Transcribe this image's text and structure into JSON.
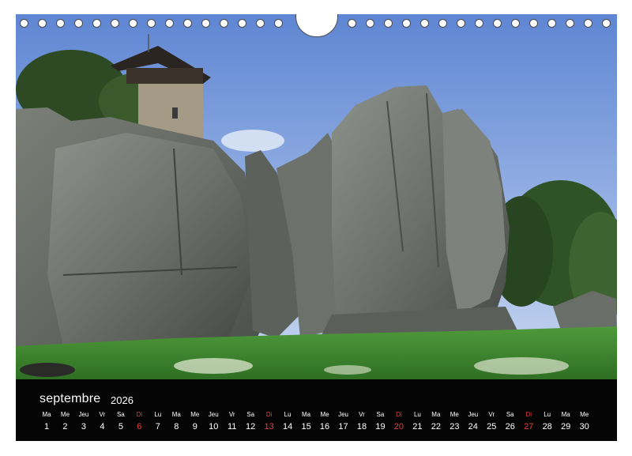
{
  "calendar": {
    "month": "septembre",
    "year": "2026",
    "days": [
      {
        "name": "Ma",
        "num": "1",
        "sunday": false
      },
      {
        "name": "Me",
        "num": "2",
        "sunday": false
      },
      {
        "name": "Jeu",
        "num": "3",
        "sunday": false
      },
      {
        "name": "Vr",
        "num": "4",
        "sunday": false
      },
      {
        "name": "Sa",
        "num": "5",
        "sunday": false
      },
      {
        "name": "Di",
        "num": "6",
        "sunday": true
      },
      {
        "name": "Lu",
        "num": "7",
        "sunday": false
      },
      {
        "name": "Ma",
        "num": "8",
        "sunday": false
      },
      {
        "name": "Me",
        "num": "9",
        "sunday": false
      },
      {
        "name": "Jeu",
        "num": "10",
        "sunday": false
      },
      {
        "name": "Vr",
        "num": "11",
        "sunday": false
      },
      {
        "name": "Sa",
        "num": "12",
        "sunday": false
      },
      {
        "name": "Di",
        "num": "13",
        "sunday": true
      },
      {
        "name": "Lu",
        "num": "14",
        "sunday": false
      },
      {
        "name": "Ma",
        "num": "15",
        "sunday": false
      },
      {
        "name": "Me",
        "num": "16",
        "sunday": false
      },
      {
        "name": "Jeu",
        "num": "17",
        "sunday": false
      },
      {
        "name": "Vr",
        "num": "18",
        "sunday": false
      },
      {
        "name": "Sa",
        "num": "19",
        "sunday": false
      },
      {
        "name": "Di",
        "num": "20",
        "sunday": true
      },
      {
        "name": "Lu",
        "num": "21",
        "sunday": false
      },
      {
        "name": "Ma",
        "num": "22",
        "sunday": false
      },
      {
        "name": "Me",
        "num": "23",
        "sunday": false
      },
      {
        "name": "Jeu",
        "num": "24",
        "sunday": false
      },
      {
        "name": "Vr",
        "num": "25",
        "sunday": false
      },
      {
        "name": "Sa",
        "num": "26",
        "sunday": false
      },
      {
        "name": "Di",
        "num": "27",
        "sunday": true
      },
      {
        "name": "Lu",
        "num": "28",
        "sunday": false
      },
      {
        "name": "Ma",
        "num": "29",
        "sunday": false
      },
      {
        "name": "Me",
        "num": "30",
        "sunday": false
      }
    ]
  },
  "colors": {
    "band": "#050505",
    "text": "#ffffff",
    "sunday": "#e0413a",
    "sky": "#6f93d6",
    "grass": "#3d8a2e"
  }
}
